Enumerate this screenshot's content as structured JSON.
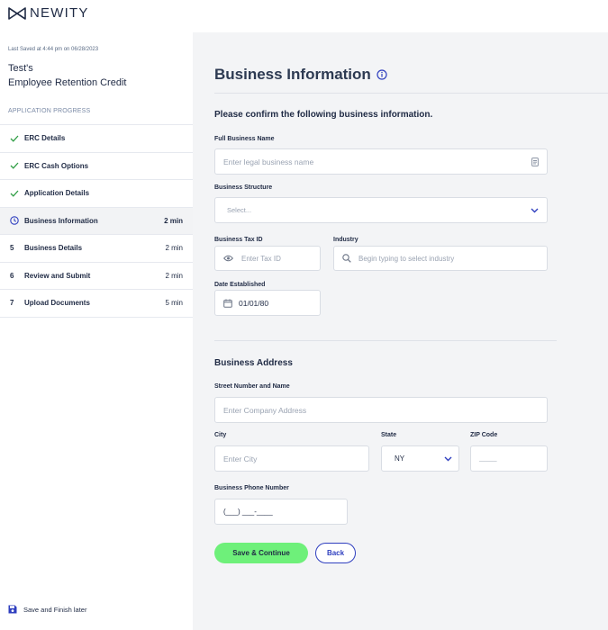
{
  "brand": {
    "name": "NEWITY"
  },
  "sidebar": {
    "last_saved": "Last Saved at 4:44 pm on 06/28/2023",
    "app_title_line1": "Test's",
    "app_title_line2": "Employee Retention Credit",
    "progress_heading": "APPLICATION PROGRESS",
    "steps": [
      {
        "marker": "check",
        "label": "ERC Details",
        "time": ""
      },
      {
        "marker": "check",
        "label": "ERC Cash Options",
        "time": ""
      },
      {
        "marker": "check",
        "label": "Application Details",
        "time": ""
      },
      {
        "marker": "clock",
        "label": "Business Information",
        "time": "2 min"
      },
      {
        "marker": "5",
        "label": "Business Details",
        "time": "2 min"
      },
      {
        "marker": "6",
        "label": "Review and Submit",
        "time": "2 min"
      },
      {
        "marker": "7",
        "label": "Upload Documents",
        "time": "5 min"
      }
    ],
    "save_later": "Save and Finish later"
  },
  "form": {
    "title": "Business Information",
    "subtitle": "Please confirm the following business information.",
    "full_name": {
      "label": "Full Business Name",
      "placeholder": "Enter legal business name"
    },
    "structure": {
      "label": "Business Structure",
      "placeholder": "Select..."
    },
    "tax_id": {
      "label": "Business Tax ID",
      "placeholder": "Enter Tax ID"
    },
    "industry": {
      "label": "Industry",
      "placeholder": "Begin typing to select industry"
    },
    "date_established": {
      "label": "Date Established",
      "value": "01/01/80"
    },
    "address_section": "Business Address",
    "street": {
      "label": "Street Number and Name",
      "placeholder": "Enter Company Address"
    },
    "city": {
      "label": "City",
      "placeholder": "Enter City"
    },
    "state": {
      "label": "State",
      "value": "NY"
    },
    "zip": {
      "label": "ZIP Code",
      "placeholder": "_____"
    },
    "phone": {
      "label": "Business Phone Number",
      "value": "(___) ___-____"
    },
    "save_button": "Save & Continue",
    "back_button": "Back"
  },
  "colors": {
    "accent_green": "#6ef07a",
    "accent_blue": "#2f3fbf",
    "check_green": "#2e9d44"
  }
}
